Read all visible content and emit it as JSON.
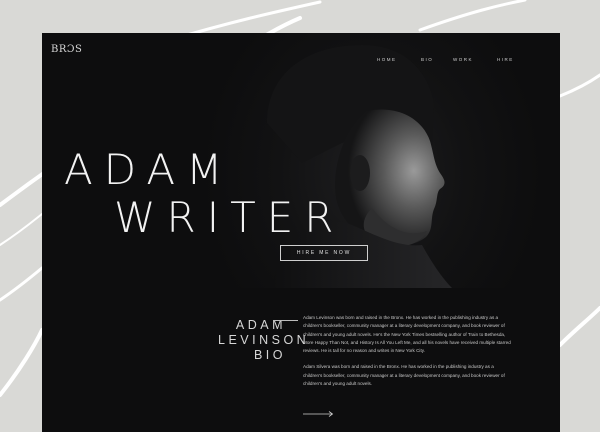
{
  "brand": {
    "logo_text": "BRƆS"
  },
  "nav": {
    "items": [
      {
        "label": "HOME"
      },
      {
        "label": "BIO"
      },
      {
        "label": "WORK"
      },
      {
        "label": "HIRE"
      }
    ]
  },
  "hero": {
    "headline_line1": "ADAM",
    "headline_line2": "WRITER",
    "cta_label": "HIRE ME NOW"
  },
  "bio": {
    "title_line1": "ADAM",
    "title_line2": "LEVINSON",
    "title_line3": "BIO",
    "paragraph1": "Adam Levinson was born and raised in the Bronx. He has worked in the publishing industry as a children's bookseller, community manager at a literary development company, and book reviewer of children's and young adult novels. He's the New York Times bestselling author of Train to Bethesda, More Happy Than Not, and History Is All You Left Me, and all his novels have received multiple starred reviews. He is tall for no reason and writes in New York City.",
    "paragraph2": "Adam Silvera was born and raised in the Bronx. He has worked in the publishing industry as a children's bookseller, community manager at a literary development company, and book reviewer of children's and young adult novels."
  },
  "colors": {
    "page_bg": "#d9d9d6",
    "site_bg": "#0d0d0e",
    "text": "#f2f2f2"
  },
  "icons": {
    "arrow": "arrow-right-icon"
  }
}
